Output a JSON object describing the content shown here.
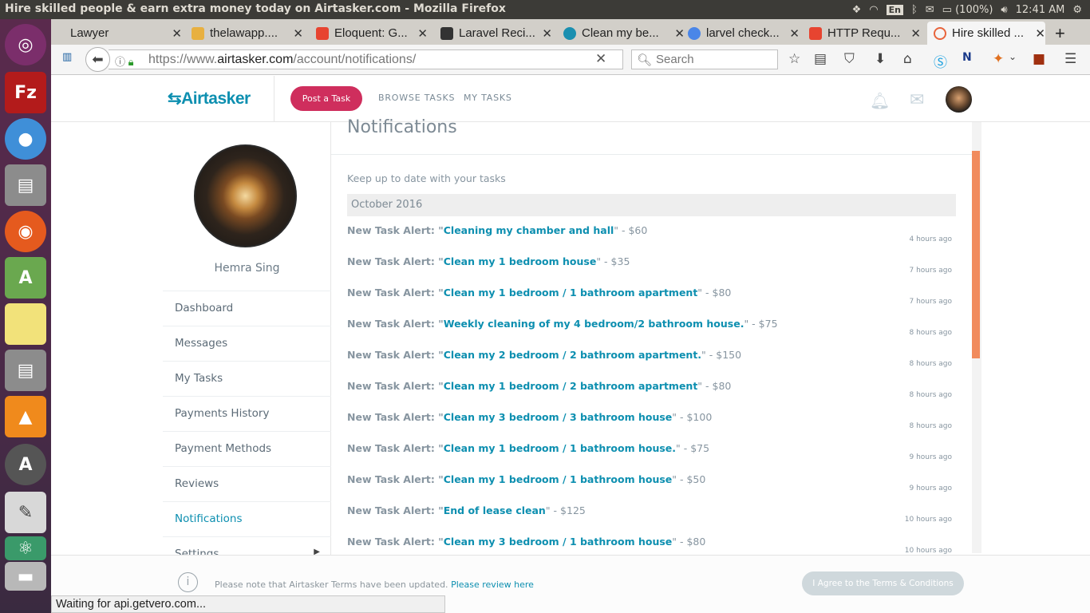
{
  "os": {
    "window_title": "Hire skilled people & earn extra money today on Airtasker.com - Mozilla Firefox",
    "keyboard_layout": "En",
    "battery": "(100%)",
    "clock": "12:41 AM"
  },
  "launcher": {
    "items": [
      "ubuntu-dash",
      "filezilla",
      "chromium",
      "file-manager",
      "firefox",
      "android-studio",
      "sticky-notes",
      "file-manager-2",
      "vlc",
      "software-updater",
      "text-editor",
      "atom",
      "disk-drives"
    ]
  },
  "browser": {
    "tabs": [
      {
        "label": "Lawyer",
        "active": false
      },
      {
        "label": "thelawapp....",
        "active": false
      },
      {
        "label": "Eloquent: G...",
        "active": false
      },
      {
        "label": "Laravel Reci...",
        "active": false
      },
      {
        "label": "Clean my be...",
        "active": false
      },
      {
        "label": "larvel check...",
        "active": false
      },
      {
        "label": "HTTP Requ...",
        "active": false
      },
      {
        "label": "Hire skilled ...",
        "active": true
      }
    ],
    "url_prefix": "https://www.",
    "url_domain": "airtasker.com",
    "url_path": "/account/notifications/",
    "search_placeholder": "Search",
    "status_text": "Waiting for api.getvero.com..."
  },
  "site": {
    "logo": "Airtasker",
    "post_task": "Post a Task",
    "browse_tasks": "BROWSE TASKS",
    "my_tasks": "MY TASKS"
  },
  "sidebar": {
    "user_name": "Hemra Sing",
    "items": [
      {
        "label": "Dashboard"
      },
      {
        "label": "Messages"
      },
      {
        "label": "My Tasks"
      },
      {
        "label": "Payments History"
      },
      {
        "label": "Payment Methods"
      },
      {
        "label": "Reviews"
      },
      {
        "label": "Notifications",
        "active": true
      },
      {
        "label": "Settings"
      }
    ]
  },
  "notifications": {
    "title": "Notifications",
    "subtitle": "Keep up to date with your tasks",
    "month": "October 2016",
    "items": [
      {
        "prefix": "New Task Alert: \"",
        "task": "Cleaning my chamber and hall",
        "suffix": "\" - $60",
        "time": "4 hours ago"
      },
      {
        "prefix": "New Task Alert: \"",
        "task": "Clean my 1 bedroom house",
        "suffix": "\" - $35",
        "time": "7 hours ago"
      },
      {
        "prefix": "New Task Alert: \"",
        "task": "Clean my 1 bedroom / 1 bathroom apartment",
        "suffix": "\" - $80",
        "time": "7 hours ago"
      },
      {
        "prefix": "New Task Alert: \"",
        "task": "Weekly cleaning of my 4 bedroom/2 bathroom house.",
        "suffix": "\" - $75",
        "time": "8 hours ago"
      },
      {
        "prefix": "New Task Alert: \"",
        "task": "Clean my 2 bedroom / 2 bathroom apartment.",
        "suffix": "\" - $150",
        "time": "8 hours ago"
      },
      {
        "prefix": "New Task Alert: \"",
        "task": "Clean my 1 bedroom / 2 bathroom apartment",
        "suffix": "\" - $80",
        "time": "8 hours ago"
      },
      {
        "prefix": "New Task Alert: \"",
        "task": "Clean my 3 bedroom / 3 bathroom house",
        "suffix": "\" - $100",
        "time": "8 hours ago"
      },
      {
        "prefix": "New Task Alert: \"",
        "task": "Clean my 1 bedroom / 1 bathroom house.",
        "suffix": "\" - $75",
        "time": "9 hours ago"
      },
      {
        "prefix": "New Task Alert: \"",
        "task": "Clean my 1 bedroom / 1 bathroom house",
        "suffix": "\" - $50",
        "time": "9 hours ago"
      },
      {
        "prefix": "New Task Alert: \"",
        "task": "End of lease clean",
        "suffix": "\" - $125",
        "time": "10 hours ago"
      },
      {
        "prefix": "New Task Alert: \"",
        "task": "Clean my 3 bedroom / 1 bathroom house",
        "suffix": "\" - $80",
        "time": "10 hours ago"
      }
    ]
  },
  "footer": {
    "note": "Please note that Airtasker Terms have been updated.",
    "review_link": "Please review here",
    "agree_button": "I Agree to the Terms & Conditions"
  },
  "colors": {
    "brand": "#0d8fb0",
    "post_button": "#cf2e5d",
    "scroll_thumb": "#f18b5d"
  }
}
